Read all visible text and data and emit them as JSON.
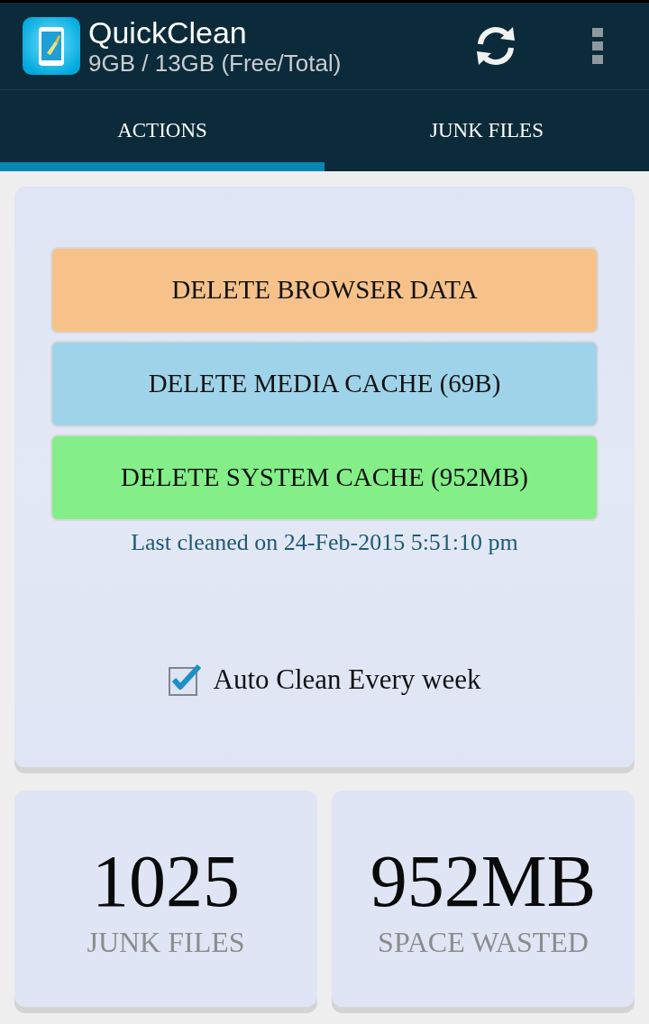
{
  "app_bar": {
    "title": "QuickClean",
    "subtitle": "9GB / 13GB (Free/Total)"
  },
  "tabs": [
    {
      "label": "ACTIONS",
      "selected": true
    },
    {
      "label": "JUNK FILES",
      "selected": false
    }
  ],
  "actions": {
    "buttons": [
      {
        "label": "DELETE BROWSER DATA",
        "color": "#f7c28a"
      },
      {
        "label": "DELETE MEDIA CACHE (69B)",
        "color": "#9fd3ea"
      },
      {
        "label": "DELETE SYSTEM CACHE (952MB)",
        "color": "#84ee88"
      }
    ],
    "last_cleaned": "Last cleaned on 24-Feb-2015 5:51:10 pm",
    "auto_clean": {
      "label": "Auto Clean Every week",
      "checked": true
    }
  },
  "stats": [
    {
      "value": "1025",
      "label": "JUNK FILES"
    },
    {
      "value": "952MB",
      "label": "SPACE WASTED"
    }
  ]
}
